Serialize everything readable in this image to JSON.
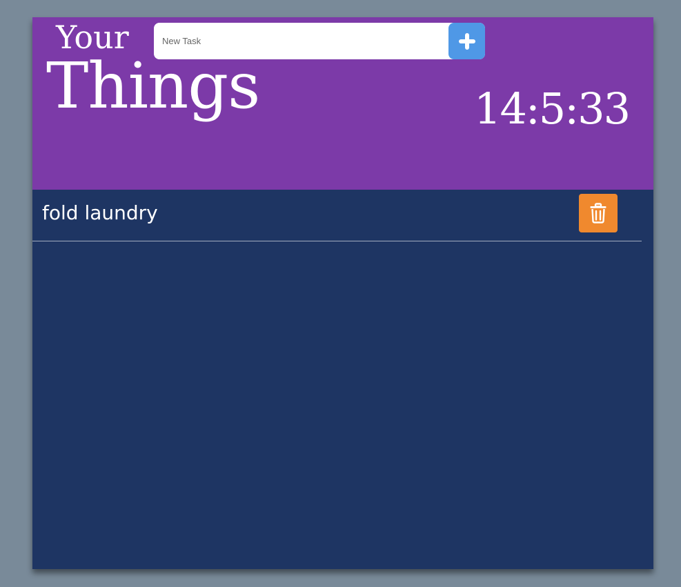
{
  "header": {
    "title_small": "Your",
    "title_large": "Things",
    "clock": "14:5:33"
  },
  "new_task": {
    "placeholder": "New Task",
    "value": "",
    "add_icon": "plus-icon"
  },
  "tasks": [
    {
      "text": "fold laundry",
      "delete_icon": "trash-icon"
    }
  ],
  "colors": {
    "page_background": "#798a99",
    "header_background": "#7c3aa8",
    "list_background": "#1e3563",
    "add_button": "#4f98e6",
    "delete_button": "#f0892e",
    "text": "#ffffff"
  }
}
